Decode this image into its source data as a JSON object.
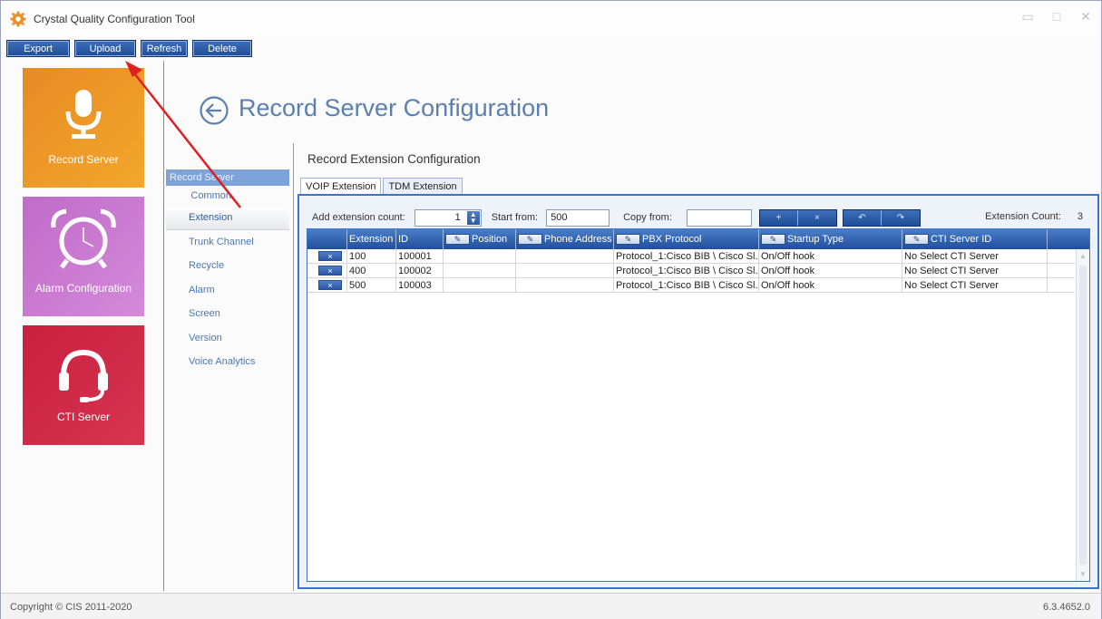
{
  "window": {
    "title": "Crystal Quality Configuration Tool",
    "controls": {
      "minimize": "▭",
      "maximize": "□",
      "close": "✕"
    }
  },
  "toolbar": {
    "export": "Export",
    "upload": "Upload",
    "refresh": "Refresh",
    "delete": "Delete"
  },
  "tiles": [
    {
      "label": "Record Server",
      "icon": "microphone-icon",
      "color": "#e98f27"
    },
    {
      "label": "Alarm Configuration",
      "icon": "alarm-clock-icon",
      "color": "#c870cf"
    },
    {
      "label": "CTI Server",
      "icon": "headset-icon",
      "color": "#cb2645"
    }
  ],
  "page": {
    "title": "Record Server Configuration",
    "back_icon": "back-arrow-icon"
  },
  "subnav": {
    "header": "Record Server",
    "items": [
      "Common",
      "Extension",
      "Trunk Channel",
      "Recycle",
      "Alarm",
      "Screen",
      "Version",
      "Voice Analytics"
    ],
    "active": "Extension"
  },
  "config": {
    "section_title": "Record Extension Configuration",
    "tabs": [
      "VOIP Extension",
      "TDM Extension"
    ],
    "active_tab": "VOIP Extension",
    "add_count_label": "Add extension count:",
    "add_count_value": "1",
    "start_from_label": "Start from:",
    "start_from_value": "500",
    "copy_from_label": "Copy from:",
    "copy_from_value": "",
    "action_buttons": [
      "+",
      "×",
      "↶",
      "↷"
    ],
    "extension_count_label": "Extension Count:",
    "extension_count_value": "3"
  },
  "grid": {
    "columns": [
      "",
      "Extension",
      "ID",
      "Position",
      "Phone Address",
      "PBX Protocol",
      "Startup Type",
      "CTI Server ID"
    ],
    "rows": [
      {
        "delete": "×",
        "extension": "100",
        "id": "100001",
        "position": "",
        "phone_address": "",
        "pbx_protocol": "Protocol_1:Cisco BIB \\ Cisco Sl...",
        "startup_type": "On/Off hook",
        "cti_server_id": "No Select CTI Server"
      },
      {
        "delete": "×",
        "extension": "400",
        "id": "100002",
        "position": "",
        "phone_address": "",
        "pbx_protocol": "Protocol_1:Cisco BIB \\ Cisco Sl...",
        "startup_type": "On/Off hook",
        "cti_server_id": "No Select CTI Server"
      },
      {
        "delete": "×",
        "extension": "500",
        "id": "100003",
        "position": "",
        "phone_address": "",
        "pbx_protocol": "Protocol_1:Cisco BIB \\ Cisco Sl...",
        "startup_type": "On/Off hook",
        "cti_server_id": "No Select CTI Server"
      }
    ]
  },
  "footer": {
    "copyright": "Copyright © CIS 2011-2020",
    "version": "6.3.4652.0"
  },
  "colors": {
    "accent_blue": "#2b5aa3",
    "title_blue": "#5a7fb0",
    "annotation_red": "#e02020"
  }
}
